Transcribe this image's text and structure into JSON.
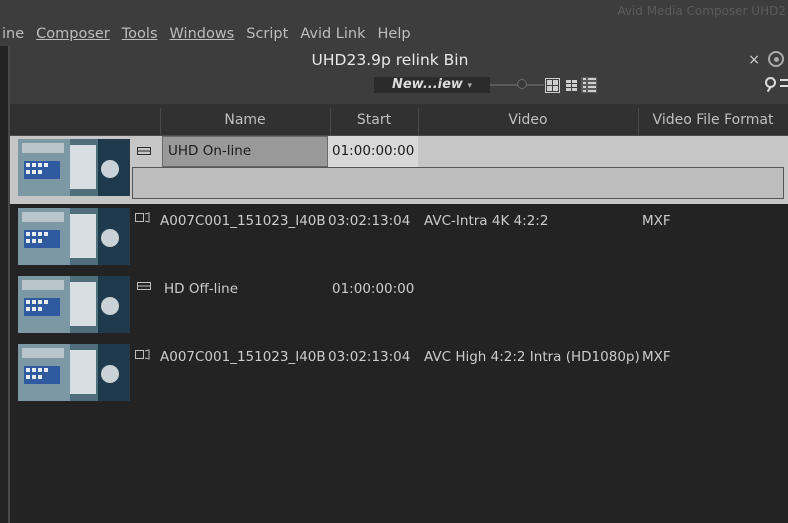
{
  "app": {
    "title": "Avid Media Composer UHD2"
  },
  "menu": [
    "ine",
    "Composer",
    "Tools",
    "Windows",
    "Script",
    "Avid Link",
    "Help"
  ],
  "bin": {
    "title": "UHD23.9p relink Bin",
    "close": "×",
    "view_name": "New...iew",
    "view_arrow": "▾"
  },
  "columns": {
    "name": "Name",
    "start": "Start",
    "video": "Video",
    "format": "Video File Format"
  },
  "rows": [
    {
      "type": "sequence-icon",
      "name": "UHD On-line",
      "start": "01:00:00:00",
      "video": "",
      "format": "",
      "selected": true
    },
    {
      "type": "clip-icon",
      "name": "A007C001_151023_I40B",
      "start": "03:02:13:04",
      "video": "AVC-Intra 4K 4:2:2",
      "format": "MXF",
      "selected": false
    },
    {
      "type": "sequence-icon",
      "name": "HD Off-line",
      "start": "01:00:00:00",
      "video": "",
      "format": "",
      "selected": false
    },
    {
      "type": "clip-icon",
      "name": "A007C001_151023_I40B",
      "start": "03:02:13:04",
      "video": "AVC High 4:2:2 Intra (HD1080p)",
      "format": "MXF",
      "selected": false
    }
  ],
  "colors": {
    "selection": "#c6c6c6",
    "background": "#232323",
    "chrome": "#3d3d3d"
  }
}
